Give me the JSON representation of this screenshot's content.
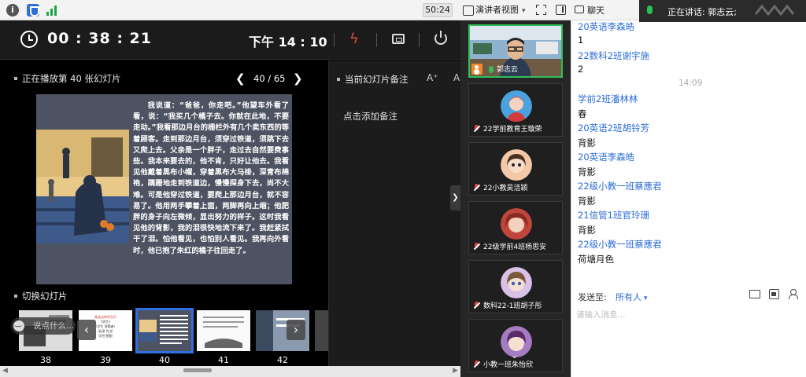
{
  "topbar": {
    "timer": "50:24",
    "presenter_view": "演讲者视图",
    "chat_title": "聊天"
  },
  "speaking": {
    "text": "正在讲话: 郭志云;"
  },
  "presenter": {
    "elapsed": "00 : 38 : 21",
    "clock": "下午 14 : 10",
    "now_playing": "正在播放第 40 张幻灯片",
    "page_counter": "40 / 65",
    "switch_label": "切换幻灯片",
    "say_placeholder": "说点什么...",
    "notes_title": "当前幻灯片备注",
    "font_up": "A⁺",
    "font_down": "A⁻",
    "notes_placeholder": "点击添加备注",
    "slide_text": "我说道：“爸爸，你走吧。”他望车外看了看，说：“我买几个橘子去。你就在此地，不要走动。”我看那边月台的栅栏外有几个卖东西的等着顾客。走到那边月台，须穿过铁道，须跳下去又爬上去。父亲是一个胖子，走过去自然要费事些。我本来要去的，他不肯，只好让他去。我看见他戴着黑布小帽，穿着黑布大马褂，深青布棉袍，蹒跚地走到铁道边，慢慢探身下去，尚不大难。可是他穿过铁道，要爬上那边月台，就不容易了。他用两手攀着上面，两脚再向上缩；他肥胖的身子向左微倾，显出努力的样子。这时我看见他的背影，我的泪很快地流下来了。我赶紧拭干了泪。怕他看见，也怕别人看见。我再向外看时，他已抱了朱红的橘子往回走了。",
    "thumbs": [
      {
        "num": "38"
      },
      {
        "num": "39",
        "line1": "来这边的学生们",
        "line2": "《学生》",
        "line3": "（学生 答题者）",
        "line4": "（自读 作业）",
        "line5": "（学生答题）"
      },
      {
        "num": "40"
      },
      {
        "num": "41"
      },
      {
        "num": "42"
      }
    ]
  },
  "participants": [
    {
      "name": "郭志云",
      "active": true
    },
    {
      "name": "22学前教育王璇荣",
      "avatar_color": "#4aa3df"
    },
    {
      "name": "22小教吴洁颖",
      "avatar_color": "#f3c8a8"
    },
    {
      "name": "22级学前4班杨思安",
      "avatar_color": "#c0453a"
    },
    {
      "name": "数科22-1班胡子彤",
      "avatar_color": "#d9c1e8"
    },
    {
      "name": "小教一班朱怡欣",
      "avatar_color": "#a57bc2"
    }
  ],
  "chat": {
    "messages": [
      {
        "kind": "sender",
        "text": "20英语李森皓"
      },
      {
        "kind": "body",
        "text": "1"
      },
      {
        "kind": "sender",
        "text": "22数科2班谢宇施"
      },
      {
        "kind": "body",
        "text": "2"
      },
      {
        "kind": "time",
        "text": "14:09"
      },
      {
        "kind": "sender",
        "text": "学前2班潘林林"
      },
      {
        "kind": "body",
        "text": "春"
      },
      {
        "kind": "sender",
        "text": "20英语2班胡铃芳"
      },
      {
        "kind": "body",
        "text": "背影"
      },
      {
        "kind": "sender",
        "text": "20英语李森皓"
      },
      {
        "kind": "body",
        "text": "背影"
      },
      {
        "kind": "sender",
        "text": "22级小教一班蔡應君"
      },
      {
        "kind": "body",
        "text": "背影"
      },
      {
        "kind": "sender",
        "text": "21信管1班官玲珊"
      },
      {
        "kind": "body",
        "text": "背影"
      },
      {
        "kind": "sender",
        "text": "22级小教一班蔡應君"
      },
      {
        "kind": "body",
        "text": "荷塘月色"
      }
    ],
    "send_to_label": "发送至:",
    "send_to_value": "所有人",
    "input_placeholder": "请输入消息..."
  }
}
